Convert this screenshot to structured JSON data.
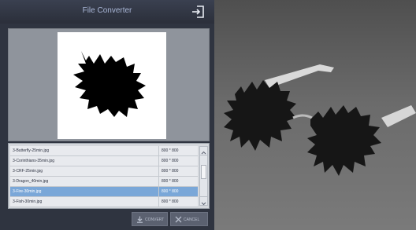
{
  "app": {
    "title": "File Converter"
  },
  "files": {
    "rows": [
      {
        "name": "3-Butterfly-25min.jpg",
        "size": "800 * 800"
      },
      {
        "name": "3-Corinthians-35min.jpg",
        "size": "800 * 800"
      },
      {
        "name": "3-CRF-25min.jpg",
        "size": "800 * 800"
      },
      {
        "name": "3-Dragon_40min.jpg",
        "size": "800 * 800"
      },
      {
        "name": "3-Fire-30min.jpg",
        "size": "800 * 800"
      },
      {
        "name": "3-Fish-30min.jpg",
        "size": "800 * 800"
      }
    ],
    "selected_index": 4
  },
  "buttons": {
    "convert": "CONVERT",
    "cancel": "CANCEL"
  },
  "icons": {
    "exit": "exit-icon",
    "convert": "download-icon",
    "cancel": "close-icon",
    "scroll_up": "chevron-up-icon",
    "scroll_down": "chevron-down-icon"
  },
  "colors": {
    "selected_row": "#7aa7d8",
    "window_bg": "#2f3440"
  }
}
